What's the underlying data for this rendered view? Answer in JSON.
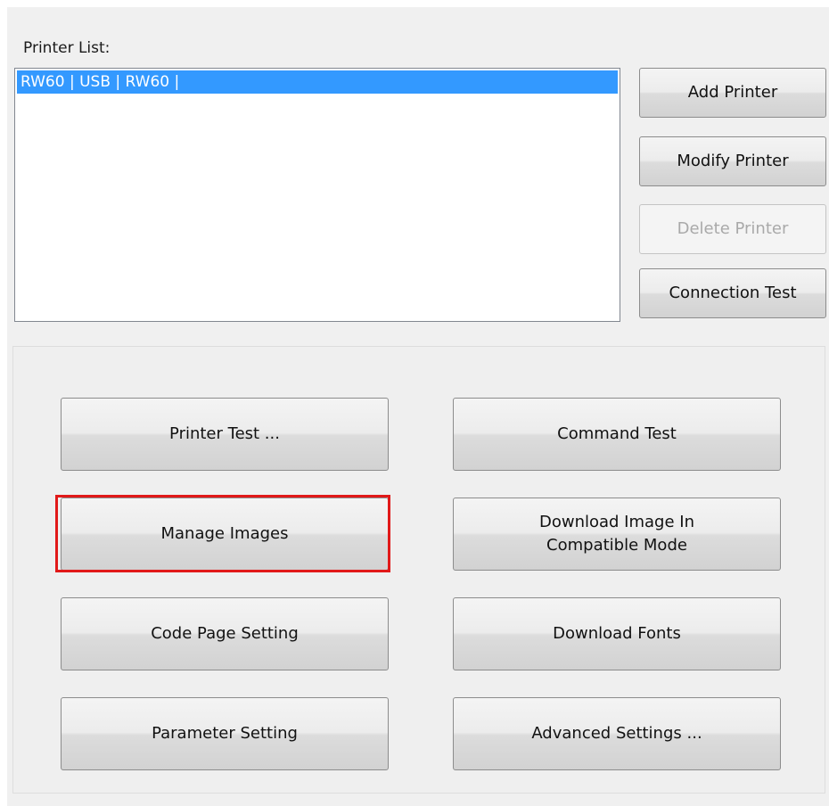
{
  "printer_list": {
    "label": "Printer List:",
    "items": [
      "RW60 | USB | RW60 |"
    ]
  },
  "side_buttons": {
    "add": "Add Printer",
    "modify": "Modify Printer",
    "delete": "Delete Printer",
    "connection_test": "Connection Test"
  },
  "main_buttons": {
    "printer_test": "Printer Test ...",
    "command_test": "Command Test",
    "manage_images": "Manage Images",
    "download_image_line1": "Download Image In",
    "download_image_line2": "Compatible Mode",
    "code_page": "Code Page Setting",
    "download_fonts": "Download Fonts",
    "parameter": "Parameter Setting",
    "advanced": "Advanced Settings ..."
  },
  "highlight_color": "#e11919",
  "selection_color": "#3399ff"
}
